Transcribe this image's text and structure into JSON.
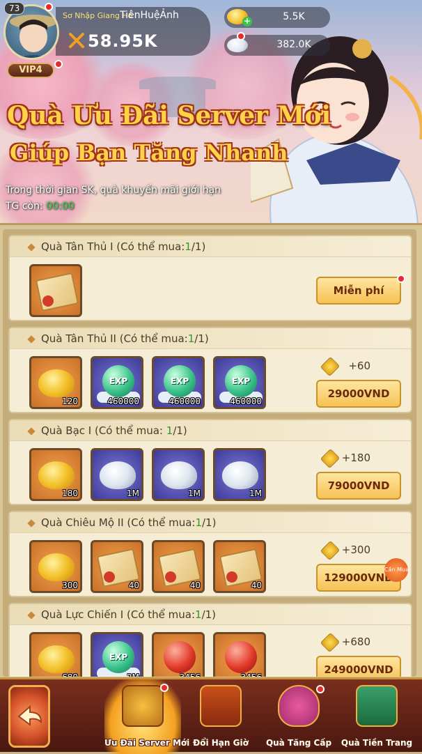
{
  "player": {
    "level": "73",
    "name_prefix": "Sơ Nhập Giang Hồ",
    "name": "TiênHuệẢnh",
    "power": "58.95K",
    "vip": "VIP4"
  },
  "resources": {
    "gold": "5.5K",
    "silver": "382.0K"
  },
  "banner": {
    "title_line1": "Quà Ưu Đãi Server Mới",
    "title_line2": "Giúp Bạn Tăng Nhanh",
    "desc": "Trong thời gian SK, quà khuyến mãi giới hạn",
    "timer_label": "TG còn:",
    "timer": "00:00",
    "timer_color": "#3bd84a"
  },
  "packs": [
    {
      "title_prefix": "Quà Tân Thủ I (Có thể mua:",
      "bought": "1",
      "title_suffix": "/1)",
      "button": "Miễn phí",
      "vip_points": "",
      "items": [
        {
          "type": "scroll",
          "qty": ""
        }
      ]
    },
    {
      "title_prefix": "Quà Tân Thủ II (Có thể mua:",
      "bought": "1",
      "title_suffix": "/1)",
      "button": "29000VND",
      "vip_points": "+60",
      "items": [
        {
          "type": "gold-ingot",
          "qty": "120"
        },
        {
          "type": "exp",
          "label": "EXP",
          "qty": "460000"
        },
        {
          "type": "exp",
          "label": "EXP",
          "qty": "460000"
        },
        {
          "type": "exp",
          "label": "EXP",
          "qty": "460000"
        }
      ]
    },
    {
      "title_prefix": "Quà Bạc I (Có thể mua: ",
      "bought": "1",
      "title_suffix": "/1)",
      "button": "79000VND",
      "vip_points": "+180",
      "items": [
        {
          "type": "gold-ingot",
          "qty": "180"
        },
        {
          "type": "silver-ingot",
          "qty": "1M"
        },
        {
          "type": "silver-ingot",
          "qty": "1M"
        },
        {
          "type": "silver-ingot",
          "qty": "1M"
        }
      ]
    },
    {
      "title_prefix": "Quà Chiêu Mộ II (Có thể mua:",
      "bought": "1",
      "title_suffix": "/1)",
      "button": "129000VND",
      "vip_points": "+300",
      "tag": "Cần Mua",
      "items": [
        {
          "type": "gold-ingot",
          "qty": "300"
        },
        {
          "type": "scroll",
          "qty": "40"
        },
        {
          "type": "scroll",
          "qty": "40"
        },
        {
          "type": "scroll",
          "qty": "40"
        }
      ]
    },
    {
      "title_prefix": "Quà Lực Chiến I (Có thể mua:",
      "bought": "1",
      "title_suffix": "/1)",
      "button": "249000VND",
      "vip_points": "+680",
      "items": [
        {
          "type": "gold-ingot",
          "qty": "680"
        },
        {
          "type": "exp",
          "label": "EXP",
          "qty": "2M"
        },
        {
          "type": "red-orb",
          "qty": "3456"
        },
        {
          "type": "red-orb",
          "qty": "3456"
        }
      ]
    }
  ],
  "tabs": [
    {
      "label": "Ưu Đãi Server Mới",
      "active": true
    },
    {
      "label": "Đổi Hạn Giờ",
      "active": false
    },
    {
      "label": "Quà Tăng Cấp",
      "active": false
    },
    {
      "label": "Quà Tiền Trang",
      "active": false
    }
  ],
  "colors": {
    "accent_green": "#2a9a2a",
    "button_text": "#6a2a08",
    "title_gold": "#ffd24a"
  }
}
